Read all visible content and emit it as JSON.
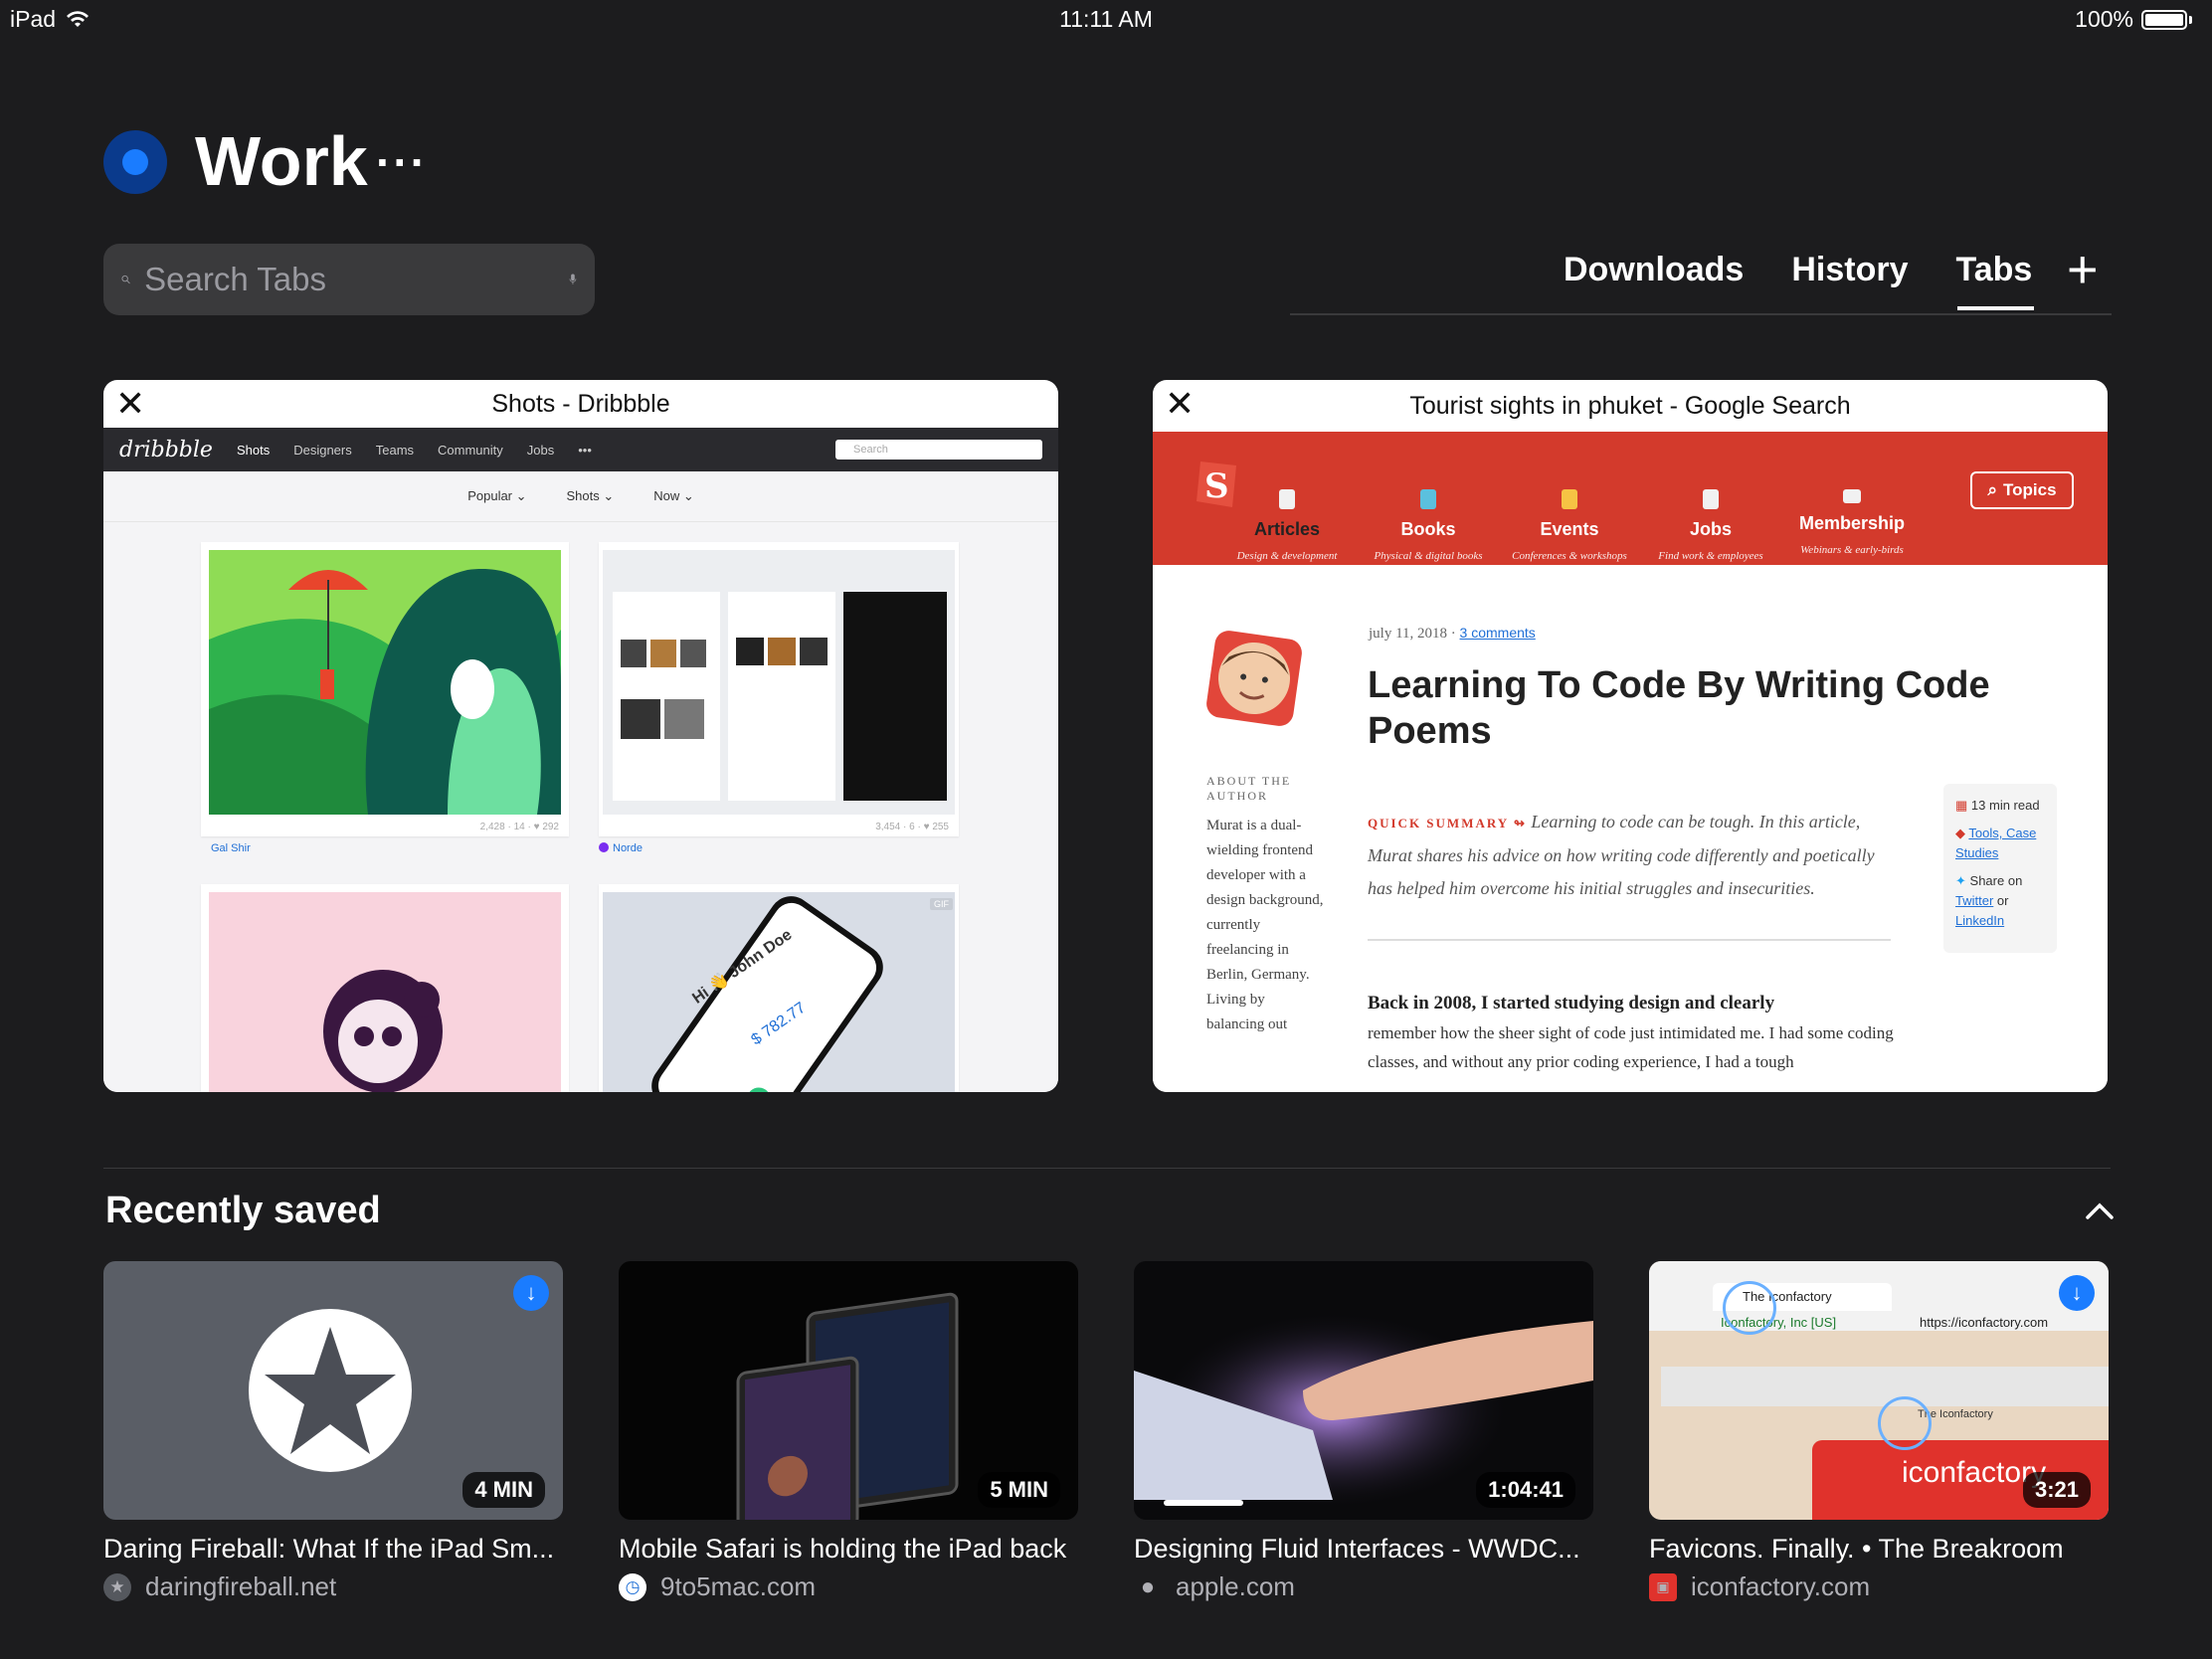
{
  "status_bar": {
    "device": "iPad",
    "time": "11:11 AM",
    "battery": "100%"
  },
  "header": {
    "group_title": "Work",
    "more": "···"
  },
  "search": {
    "placeholder": "Search Tabs"
  },
  "nav": {
    "downloads": "Downloads",
    "history": "History",
    "tabs": "Tabs",
    "add": "+"
  },
  "tabs": [
    {
      "title": "Shots - Dribbble",
      "page": {
        "logo": "dribbble",
        "nav_items": [
          "Shots",
          "Designers",
          "Teams",
          "Community",
          "Jobs",
          "•••"
        ],
        "search_placeholder": "Search",
        "filters": [
          "Popular ⌄",
          "Shots ⌄",
          "Now ⌄"
        ],
        "shots": [
          {
            "author": "Gal Shir",
            "views": "2,428",
            "comments": "14",
            "likes": "292"
          },
          {
            "author": "Norde",
            "views": "3,454",
            "comments": "6",
            "likes": "255"
          }
        ],
        "phone_text": {
          "greeting": "Hi 👋 John Doe",
          "balance": "$ 782.77"
        },
        "gif_badge": "GIF"
      }
    },
    {
      "title": "Tourist sights in phuket - Google Search",
      "page": {
        "nav": [
          {
            "label": "Articles",
            "sub": "Design & development"
          },
          {
            "label": "Books",
            "sub": "Physical & digital books"
          },
          {
            "label": "Events",
            "sub": "Conferences & workshops"
          },
          {
            "label": "Jobs",
            "sub": "Find work & employees"
          },
          {
            "label": "Membership",
            "sub": "Webinars & early-birds"
          }
        ],
        "topics": "Topics",
        "date": "july 11, 2018",
        "comments": "3 comments",
        "headline": "Learning To Code By Writing Code Poems",
        "about_label": "ABOUT THE AUTHOR",
        "about_text": "Murat is a dual-wielding frontend developer with a design background, currently freelancing in Berlin, Germany. Living by balancing out",
        "summary_label": "QUICK SUMMARY ↬",
        "summary": "Learning to code can be tough. In this article, Murat shares his advice on how writing code differently and poetically has helped him overcome his initial struggles and insecurities.",
        "meta": {
          "read": "13 min read",
          "tags": "Tools, Case Studies",
          "share": "Share on",
          "twitter": "Twitter",
          "or": "or",
          "linkedin": "LinkedIn"
        },
        "body_bold": "Back in 2008, I started studying design and clearly",
        "body": "remember how the sheer sight of code just intimidated me. I had some coding classes, and without any prior coding experience, I had a tough"
      }
    }
  ],
  "recently_saved": {
    "title": "Recently saved",
    "items": [
      {
        "title": "Daring Fireball: What If the iPad Sm...",
        "site": "daringfireball.net",
        "duration": "4 MIN",
        "downloaded": true
      },
      {
        "title": "Mobile Safari is holding the iPad back",
        "site": "9to5mac.com",
        "duration": "5 MIN",
        "downloaded": false
      },
      {
        "title": "Designing Fluid Interfaces - WWDC...",
        "site": "apple.com",
        "duration": "1:04:41",
        "downloaded": false
      },
      {
        "title": "Favicons. Finally. • The Breakroom",
        "site": "iconfactory.com",
        "duration": "3:21",
        "downloaded": true,
        "thumb_text": {
          "tab": "The Iconfactory",
          "url_org": "Iconfactory, Inc [US]",
          "url": "https://iconfactory.com",
          "tab2": "The Iconfactory",
          "brand": "iconfactory"
        }
      }
    ]
  },
  "colors": {
    "background": "#1c1c1e",
    "accent": "#1a7cff",
    "smashing_red": "#d33a2c"
  }
}
